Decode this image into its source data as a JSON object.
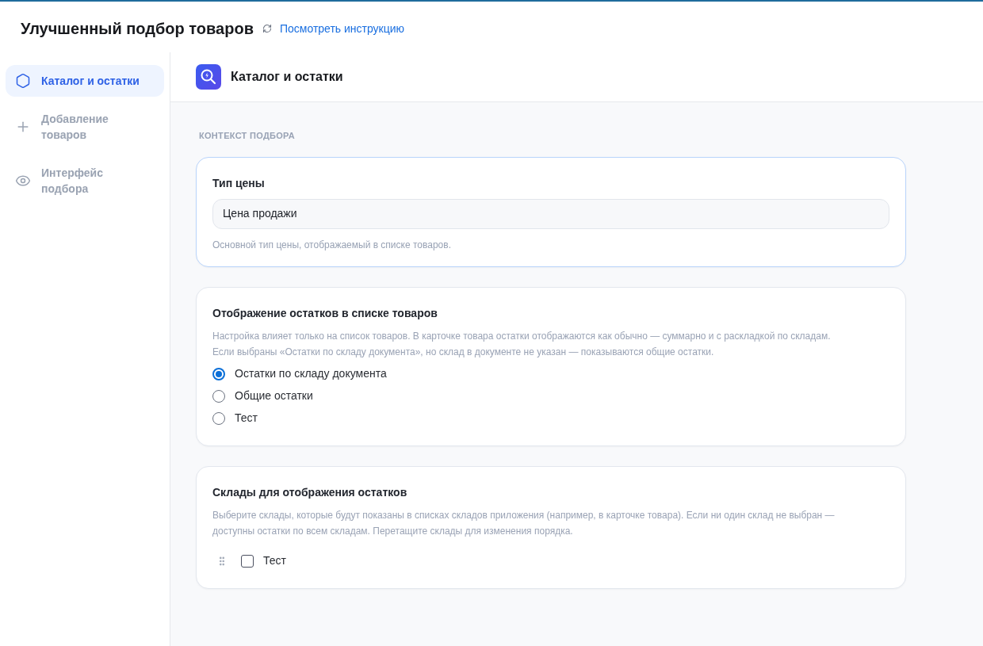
{
  "header": {
    "title": "Улучшенный подбор товаров",
    "link": "Посмотреть инструкцию"
  },
  "sidebar": {
    "items": [
      {
        "label": "Каталог и остатки",
        "selected": true
      },
      {
        "label": "Добавление товаров",
        "selected": false
      },
      {
        "label": "Интерфейс подбора",
        "selected": false
      }
    ]
  },
  "main": {
    "title": "Каталог и остатки",
    "section_label": "КОНТЕКСТ ПОДБОРА",
    "cards": [
      {
        "kind": "field",
        "focused": true,
        "title": "Тип цены",
        "value": "Цена продажи",
        "hint": "Основной тип цены, отображаемый в списке товаров."
      },
      {
        "kind": "radio",
        "focused": false,
        "title": "Отображение остатков в списке товаров",
        "description": "Настройка влияет только на список товаров. В карточке товара остатки отображаются как обычно — суммарно и с раскладкой по складам. Если выбраны «Остатки по складу документа», но склад в документе не указан — показываются общие остатки.",
        "options": [
          {
            "label": "Остатки по складу документа",
            "selected": true
          },
          {
            "label": "Общие остатки",
            "selected": false
          },
          {
            "label": "Тест",
            "selected": false
          }
        ]
      },
      {
        "kind": "checklist",
        "focused": false,
        "title": "Склады для отображения остатков",
        "description": "Выберите склады, которые будут показаны в списках складов приложения (например, в карточке товара). Если ни один склад не выбран — доступны остатки по всем складам. Перетащите склады для изменения порядка.",
        "items": [
          {
            "label": "Тест",
            "checked": false
          }
        ]
      }
    ]
  }
}
